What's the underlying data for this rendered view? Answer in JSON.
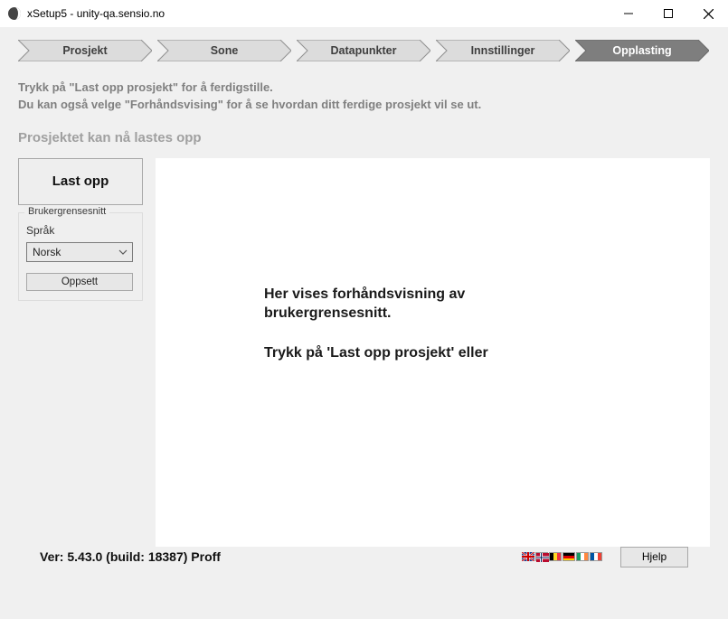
{
  "window": {
    "title": "xSetup5 - unity-qa.sensio.no"
  },
  "wizard": {
    "steps": [
      {
        "label": "Prosjekt",
        "active": false
      },
      {
        "label": "Sone",
        "active": false
      },
      {
        "label": "Datapunkter",
        "active": false
      },
      {
        "label": "Innstillinger",
        "active": false
      },
      {
        "label": "Opplasting",
        "active": true
      }
    ]
  },
  "instructions": {
    "line1": "Trykk på \"Last opp prosjekt\" for å ferdigstille.",
    "line2": "Du kan også velge \"Forhåndsvising\" for å se hvordan ditt ferdige prosjekt vil se ut."
  },
  "subheading": "Prosjektet kan nå lastes opp",
  "side": {
    "upload_label": "Last opp",
    "panel_legend": "Brukergrensesnitt",
    "language_label": "Språk",
    "language_value": "Norsk",
    "setup_label": "Oppsett"
  },
  "preview": {
    "p1": "Her vises forhåndsvisning av brukergrensesnitt.",
    "p2": "Trykk på 'Last opp prosjekt' eller"
  },
  "footer": {
    "version": "Ver: 5.43.0 (build: 18387) Proff",
    "help_label": "Hjelp"
  },
  "colors": {
    "step_fill": "#dcdcdc",
    "step_active_fill": "#7e7e7e",
    "step_stroke": "#8f8f8f"
  }
}
